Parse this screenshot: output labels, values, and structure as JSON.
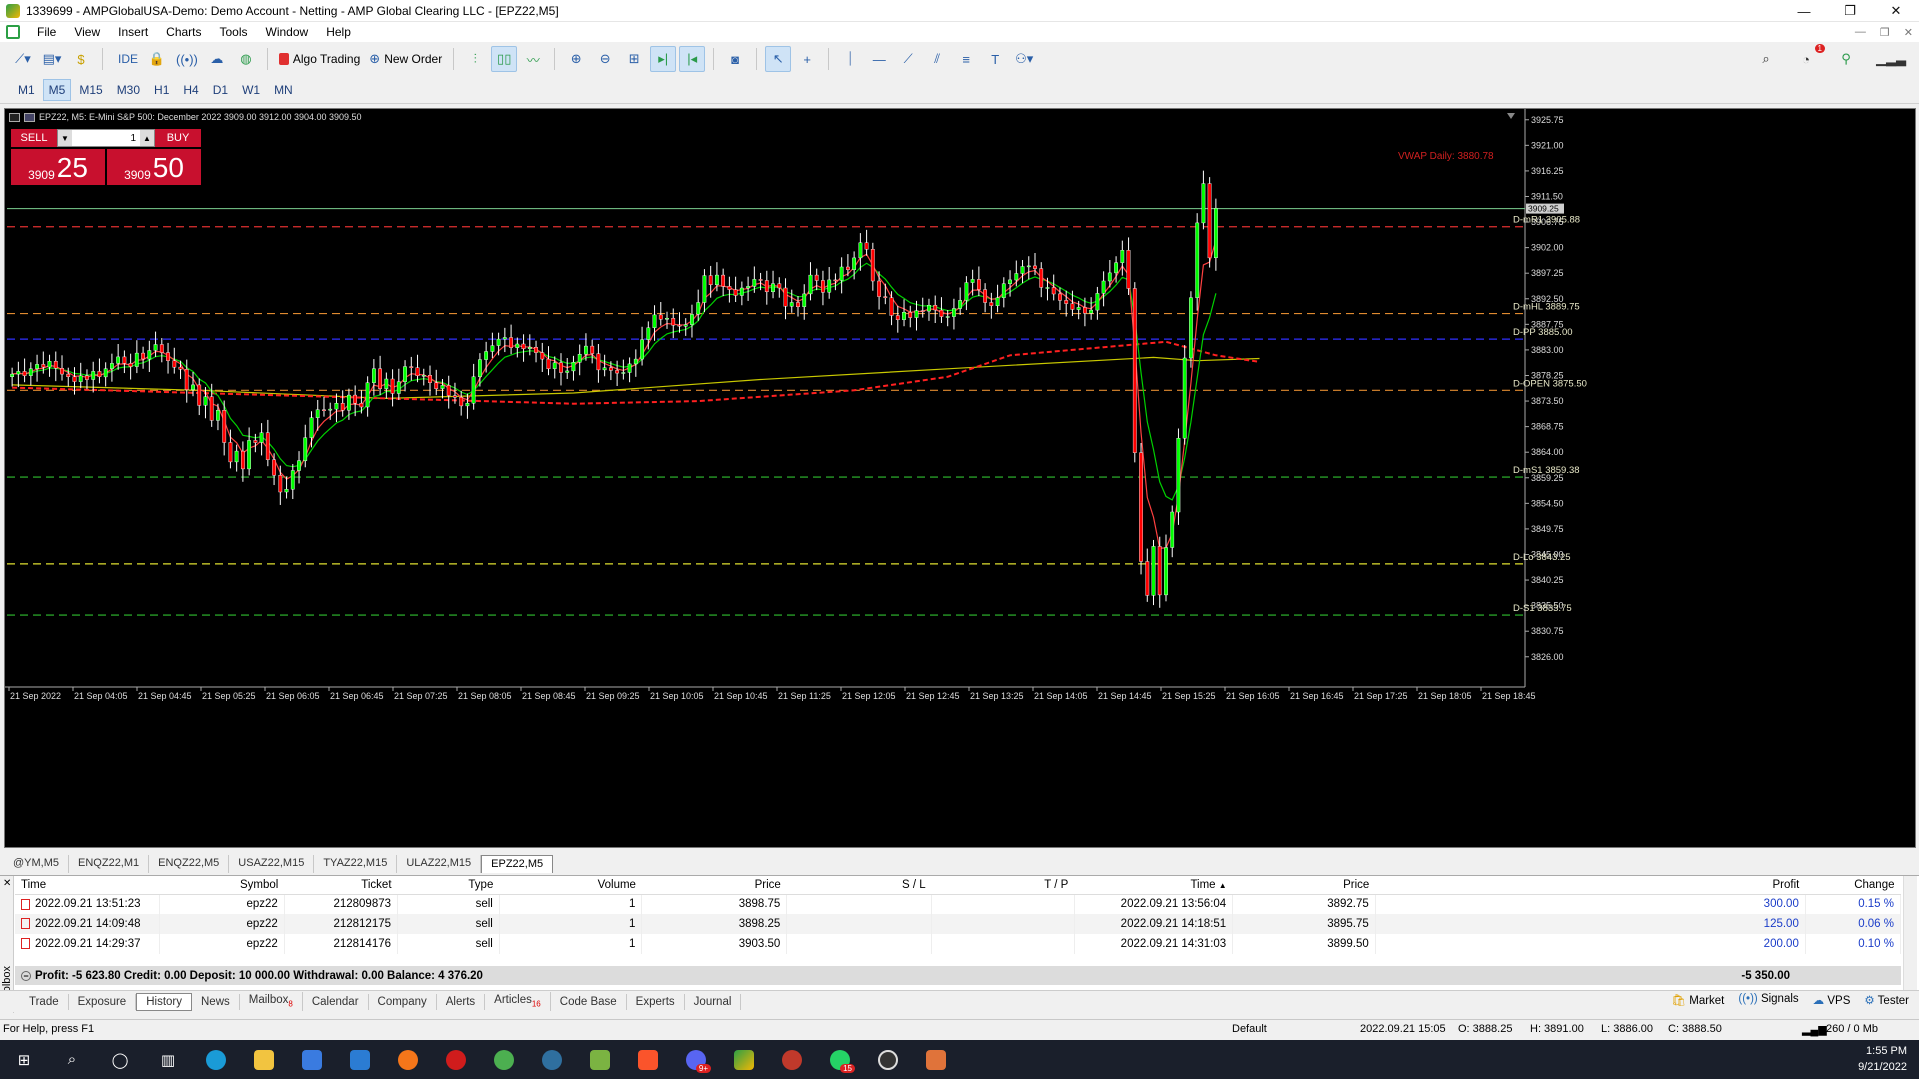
{
  "window": {
    "title": "1339699 - AMPGlobalUSA-Demo: Demo Account - Netting - AMP Global Clearing LLC - [EPZ22,M5]",
    "controls": [
      "—",
      "❐",
      "✕"
    ]
  },
  "menu": {
    "items": [
      "File",
      "View",
      "Insert",
      "Charts",
      "Tools",
      "Window",
      "Help"
    ],
    "mdi_controls": [
      "—",
      "❐",
      "✕"
    ]
  },
  "toolbar": {
    "ide_label": "IDE",
    "algo_trading_label": "Algo Trading",
    "new_order_label": "New Order",
    "notification_count": "1",
    "icons": [
      "chart-line-icon",
      "template-icon",
      "dollar-icon",
      "ide-icon",
      "bag-icon",
      "signal-icon",
      "cloud-icon",
      "globe-icon",
      "bar-chart-icon",
      "candles-icon",
      "line-chart-icon",
      "zoom-in-icon",
      "zoom-out-icon",
      "grid-icon",
      "autoscroll-icon",
      "chart-shift-icon",
      "screenshot-icon",
      "cursor-icon",
      "crosshair-icon",
      "vertical-line-icon",
      "horizontal-line-icon",
      "trend-line-icon",
      "channel-icon",
      "fibonacci-icon",
      "text-icon",
      "shapes-icon"
    ]
  },
  "timeframes": {
    "items": [
      "M1",
      "M5",
      "M15",
      "M30",
      "H1",
      "H4",
      "D1",
      "W1",
      "MN"
    ],
    "active": "M5"
  },
  "chart": {
    "header": "EPZ22, M5:  E-Mini S&P 500: December 2022  3909.00 3912.00 3904.00 3909.50",
    "one_click": {
      "sell_label": "SELL",
      "buy_label": "BUY",
      "lot": "1",
      "sell_price_small": "3909",
      "sell_price_big": "25",
      "buy_price_small": "3909",
      "buy_price_big": "50"
    },
    "vwap_label": "VWAP Daily: 3880.78",
    "current_price_tag": "3909.25",
    "colors": {
      "bg": "#000000",
      "bull": "#00ff00",
      "bear": "#ff0000",
      "vwap": "#ff2020",
      "sma": "#c8c800",
      "fast_ma": "#ff4040",
      "slow_ma": "#00d000"
    }
  },
  "chart_data": {
    "type": "candlestick",
    "symbol": "EPZ22",
    "timeframe": "M5",
    "ylim": [
      3821.5,
      3927.75
    ],
    "y_ticks": [
      "3925.75",
      "3921.00",
      "3916.25",
      "3911.50",
      "3906.75",
      "3902.00",
      "3897.25",
      "3892.50",
      "3887.75",
      "3883.00",
      "3878.25",
      "3873.50",
      "3868.75",
      "3864.00",
      "3859.25",
      "3854.50",
      "3849.75",
      "3845.00",
      "3840.25",
      "3835.50",
      "3830.75",
      "3826.00"
    ],
    "x_ticks": [
      "21 Sep 2022",
      "21 Sep 04:05",
      "21 Sep 04:45",
      "21 Sep 05:25",
      "21 Sep 06:05",
      "21 Sep 06:45",
      "21 Sep 07:25",
      "21 Sep 08:05",
      "21 Sep 08:45",
      "21 Sep 09:25",
      "21 Sep 10:05",
      "21 Sep 10:45",
      "21 Sep 11:25",
      "21 Sep 12:05",
      "21 Sep 12:45",
      "21 Sep 13:25",
      "21 Sep 14:05",
      "21 Sep 14:45",
      "21 Sep 15:25",
      "21 Sep 16:05",
      "21 Sep 16:45",
      "21 Sep 17:25",
      "21 Sep 18:05",
      "21 Sep 18:45"
    ],
    "levels": [
      {
        "label": "D-mR1 3905.88",
        "price": 3905.88,
        "color": "#e03030",
        "dash": "dash"
      },
      {
        "label": "D-mHL 3889.75",
        "price": 3889.75,
        "color": "#e08a30",
        "dash": "dash"
      },
      {
        "label": "D-PP 3885.00",
        "price": 3885.0,
        "color": "#3030ff",
        "dash": "dash"
      },
      {
        "label": "D-OPEN 3875.50",
        "price": 3875.5,
        "color": "#e08a30",
        "dash": "dash"
      },
      {
        "label": "D-mS1 3859.38",
        "price": 3859.38,
        "color": "#30c030",
        "dash": "dash"
      },
      {
        "label": "D-Lo 3843.25",
        "price": 3843.25,
        "color": "#e0e030",
        "dash": "dash"
      },
      {
        "label": "D-S1 3833.75",
        "price": 3833.75,
        "color": "#30c030",
        "dash": "dash"
      }
    ],
    "bid_line": 3909.25,
    "closes": [
      3878.5,
      3879,
      3878.2,
      3879.5,
      3880.3,
      3879.8,
      3880.9,
      3879.6,
      3878.5,
      3878,
      3877.1,
      3878.2,
      3877.5,
      3879,
      3878,
      3879.5,
      3880.5,
      3881.7,
      3880.5,
      3879.9,
      3882.4,
      3881.3,
      3882.9,
      3884,
      3882.5,
      3881,
      3879.8,
      3879.4,
      3875.6,
      3876.5,
      3872.7,
      3874.3,
      3869.9,
      3871.8,
      3865.8,
      3862.2,
      3864.2,
      3860.9,
      3866.2,
      3865.8,
      3867.6,
      3862.6,
      3859.7,
      3856.6,
      3857.1,
      3860.6,
      3862.4,
      3866.7,
      3870.4,
      3871.9,
      3871.8,
      3872,
      3873.1,
      3871.8,
      3874.6,
      3873.1,
      3872.4,
      3876.9,
      3879.5,
      3875.8,
      3877.6,
      3874.9,
      3877.1,
      3879.9,
      3879.7,
      3878.2,
      3878.3,
      3876.9,
      3875.8,
      3876.4,
      3874.5,
      3874.2,
      3872.6,
      3873.1,
      3878,
      3881.2,
      3882.7,
      3883.8,
      3885,
      3885.3,
      3883.4,
      3884.1,
      3883.2,
      3883.5,
      3882.5,
      3881.3,
      3879.5,
      3880.6,
      3878.8,
      3879.1,
      3880.7,
      3882.2,
      3883.7,
      3882.3,
      3879.3,
      3879.7,
      3879.2,
      3878.7,
      3878.8,
      3880.4,
      3881.3,
      3884.9,
      3887.1,
      3889.5,
      3888.7,
      3888.9,
      3887.6,
      3887.4,
      3887.7,
      3889.6,
      3891.8,
      3896.8,
      3895.1,
      3896.9,
      3894.8,
      3894.2,
      3893.1,
      3894.5,
      3894.8,
      3896.1,
      3895.9,
      3893.8,
      3895.3,
      3894.5,
      3891.1,
      3891.8,
      3891,
      3893.4,
      3896.9,
      3895.9,
      3893.7,
      3896,
      3895.9,
      3898.4,
      3897.9,
      3900.1,
      3902.9,
      3901.7,
      3895.8,
      3892.9,
      3892.7,
      3889.4,
      3888.6,
      3890,
      3889,
      3890.3,
      3890.2,
      3891.3,
      3890.4,
      3889.2,
      3889.2,
      3890.7,
      3892.2,
      3895.5,
      3896.1,
      3894.2,
      3891.8,
      3891.2,
      3892.7,
      3895.3,
      3896,
      3897.2,
      3898.5,
      3898.6,
      3898.1,
      3894.6,
      3894.6,
      3893.4,
      3892.2,
      3891.6,
      3890.5,
      3890.9,
      3889.8,
      3890.4,
      3893.5,
      3895.8,
      3897.3,
      3899.2,
      3901.5,
      3894.4,
      3863.9,
      3843.7,
      3837.4,
      3846.5,
      3837.5,
      3846.3,
      3852.9,
      3866.6,
      3881.5,
      3892.7,
      3906.6,
      3913.9,
      3900.1,
      3909.3
    ],
    "vwap": [
      [
        0,
        3876
      ],
      [
        30,
        3875
      ],
      [
        60,
        3874
      ],
      [
        90,
        3873
      ],
      [
        110,
        3873.5
      ],
      [
        135,
        3875.5
      ],
      [
        150,
        3878
      ],
      [
        160,
        3882
      ],
      [
        175,
        3883.5
      ],
      [
        185,
        3884.5
      ],
      [
        193,
        3882
      ],
      [
        200,
        3880.78
      ]
    ],
    "sma": [
      [
        0,
        3876.5
      ],
      [
        30,
        3875.5
      ],
      [
        60,
        3874
      ],
      [
        90,
        3875
      ],
      [
        120,
        3877.5
      ],
      [
        150,
        3879.5
      ],
      [
        183,
        3881.6
      ],
      [
        190,
        3881
      ],
      [
        200,
        3881.4
      ]
    ]
  },
  "symbol_tabs": [
    "@YM,M5",
    "ENQZ22,M1",
    "ENQZ22,M5",
    "USAZ22,M15",
    "TYAZ22,M15",
    "ULAZ22,M15",
    "EPZ22,M5"
  ],
  "active_symbol_tab": "EPZ22,M5",
  "history": {
    "columns": [
      "Time",
      "Symbol",
      "Ticket",
      "Type",
      "Volume",
      "Price",
      "S / L",
      "T / P",
      "Time",
      "Price",
      "Profit",
      "Change"
    ],
    "rows": [
      [
        "2022.09.21 13:51:23",
        "epz22",
        "212809873",
        "sell",
        "1",
        "3898.75",
        "",
        "",
        "2022.09.21 13:56:04",
        "3892.75",
        "300.00",
        "0.15 %"
      ],
      [
        "2022.09.21 14:09:48",
        "epz22",
        "212812175",
        "sell",
        "1",
        "3898.25",
        "",
        "",
        "2022.09.21 14:18:51",
        "3895.75",
        "125.00",
        "0.06 %"
      ],
      [
        "2022.09.21 14:29:37",
        "epz22",
        "212814176",
        "sell",
        "1",
        "3903.50",
        "",
        "",
        "2022.09.21 14:31:03",
        "3899.50",
        "200.00",
        "0.10 %"
      ]
    ],
    "summary": "Profit: -5 623.80  Credit: 0.00  Deposit: 10 000.00  Withdrawal: 0.00  Balance: 4 376.20",
    "summary_total": "-5 350.00",
    "toolbox_label": "Toolbox"
  },
  "bottom_tabs": [
    {
      "label": "Trade",
      "badge": ""
    },
    {
      "label": "Exposure",
      "badge": ""
    },
    {
      "label": "History",
      "badge": ""
    },
    {
      "label": "News",
      "badge": ""
    },
    {
      "label": "Mailbox",
      "badge": "8"
    },
    {
      "label": "Calendar",
      "badge": ""
    },
    {
      "label": "Company",
      "badge": ""
    },
    {
      "label": "Alerts",
      "badge": ""
    },
    {
      "label": "Articles",
      "badge": "16"
    },
    {
      "label": "Code Base",
      "badge": ""
    },
    {
      "label": "Experts",
      "badge": ""
    },
    {
      "label": "Journal",
      "badge": ""
    }
  ],
  "active_bottom_tab": "History",
  "bottom_right": [
    "Market",
    "Signals",
    "VPS",
    "Tester"
  ],
  "status": {
    "help": "For Help, press F1",
    "profile": "Default",
    "datetime": "2022.09.21 15:05",
    "open": "O: 3888.25",
    "high": "H: 3891.00",
    "low": "L: 3886.00",
    "close": "C: 3888.50",
    "traffic": "260 / 0 Mb"
  },
  "taskbar": {
    "time": "1:55 PM",
    "date": "9/21/2022",
    "badges": {
      "whatsapp": "15",
      "discord": "9+"
    }
  }
}
